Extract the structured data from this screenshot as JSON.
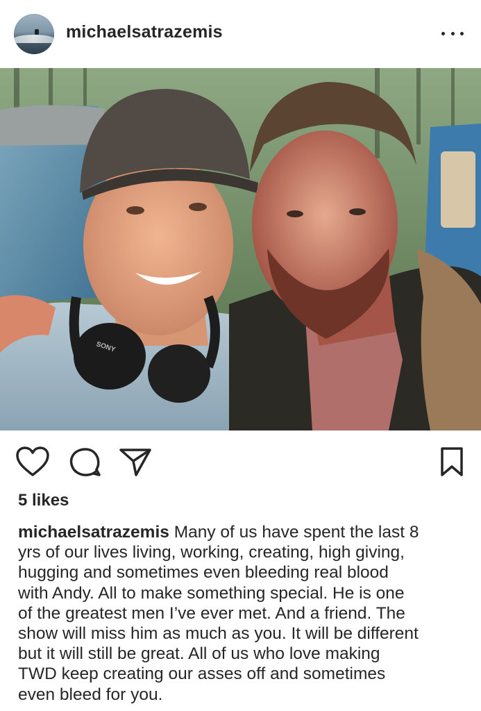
{
  "post": {
    "username": "michaelsatrazemis",
    "likes_text": "5 likes",
    "caption_user": "michaelsatrazemis",
    "caption_lines": [
      "Many of us have spent the last 8",
      "yrs of our lives living, working, creating, high giving,",
      "hugging and sometimes even bleeding real blood",
      "with Andy. All to make something special. He is one",
      "of the greatest men I’ve ever met. And a friend. The",
      "show will miss him as much as you. It will be different",
      "but it will still be great. All of us who love making",
      "TWD keep creating our asses off and sometimes",
      "even bleed for you."
    ]
  },
  "icons": {
    "more": "more-options-icon",
    "like": "heart-icon",
    "comment": "comment-bubble-icon",
    "share": "paper-plane-icon",
    "save": "bookmark-icon",
    "headphones_brand": "SONY"
  },
  "colors": {
    "text": "#262626",
    "background": "#ffffff"
  }
}
